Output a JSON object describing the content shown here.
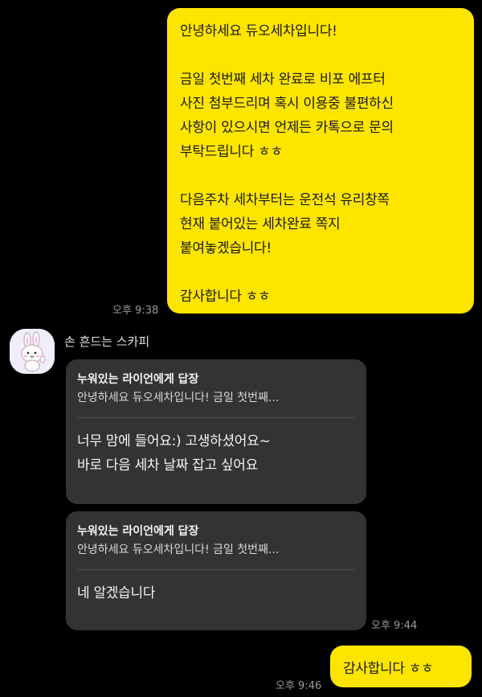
{
  "messages": {
    "out1": {
      "paragraphs": [
        "안녕하세요 듀오세차입니다!",
        "금일 첫번째 세차 완료로 비포 에프터\n사진 첨부드리며 혹시 이용중 불편하신\n사항이 있으시면 언제든 카톡으로 문의\n부탁드립니다 ㅎㅎ",
        "다음주차 세차부터는 운전석 유리창쪽\n현재 붙어있는 세차완료 쪽지\n붙여놓겠습니다!",
        "감사합니다 ㅎㅎ"
      ],
      "time": "오후 9:38"
    },
    "sender": {
      "name": "손 흔드는 스카피",
      "avatar_icon": "bunny-avatar-icon"
    },
    "in1": {
      "reply_title": "누워있는 라이언에게 답장",
      "reply_quote": "안녕하세요 듀오세차입니다!  금일 첫번째...",
      "body": "너무 맘에 들어요:) 고생하셨어요~\n바로 다음 세차 날짜 잡고 싶어요"
    },
    "in2": {
      "reply_title": "누워있는 라이언에게 답장",
      "reply_quote": "안녕하세요 듀오세차입니다!  금일 첫번째...",
      "body": "네 알겠습니다",
      "time": "오후 9:44"
    },
    "out2": {
      "text": "감사합니다 ㅎㅎ",
      "time": "오후 9:46"
    }
  },
  "colors": {
    "background": "#000000",
    "outgoing_bubble": "#FEE500",
    "incoming_bubble": "#333333",
    "timestamp": "#9a9a9a"
  }
}
